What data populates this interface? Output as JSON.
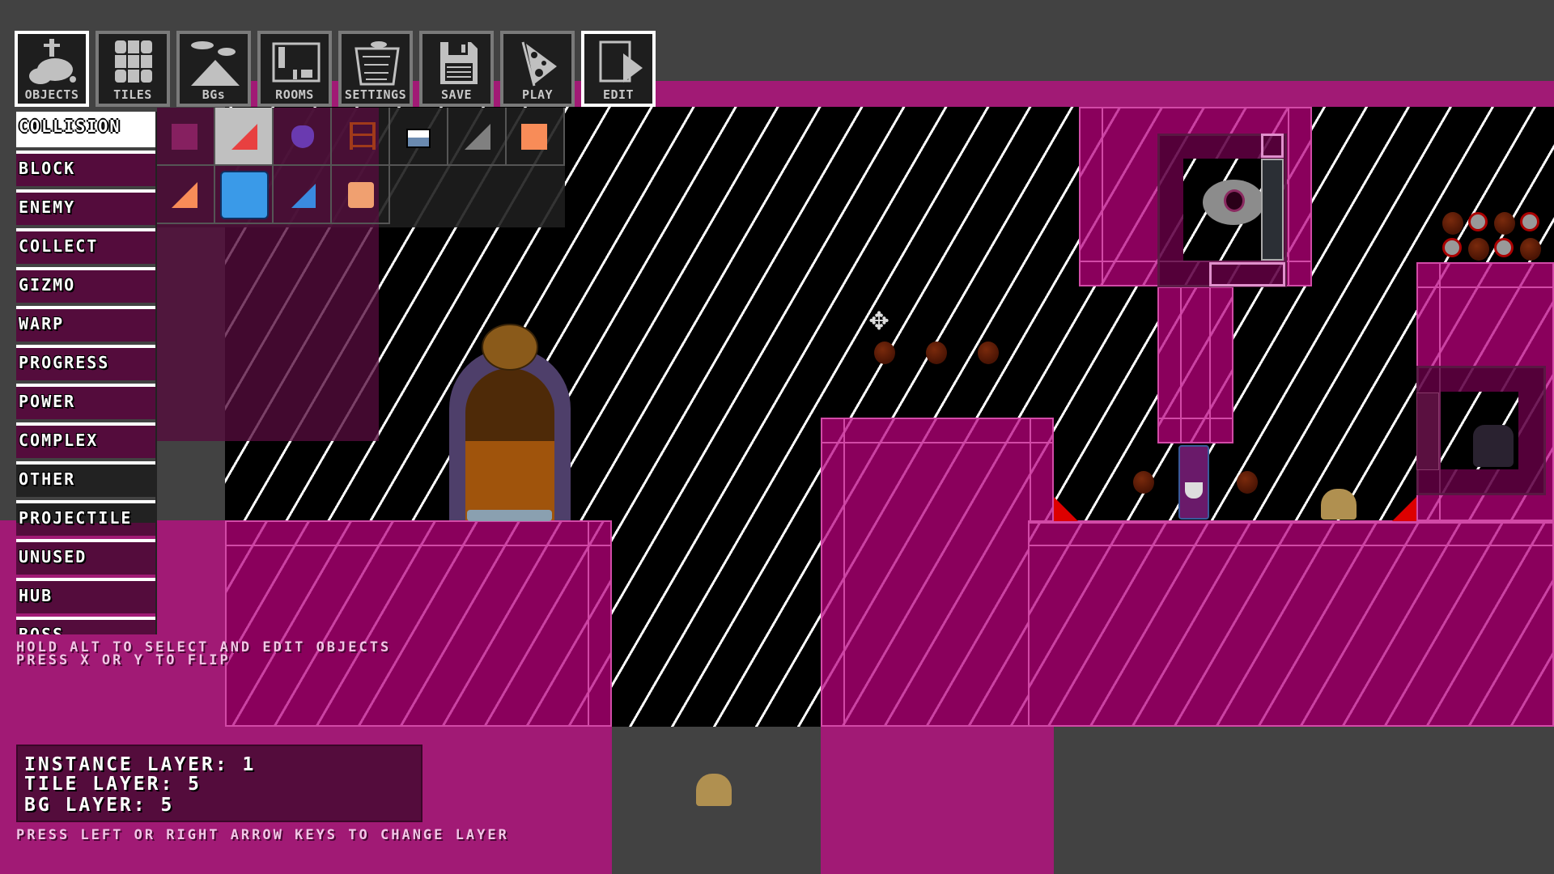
{
  "toolbar": {
    "buttons": [
      {
        "label": "OBJECTS",
        "icon": "objects-icon",
        "active": true
      },
      {
        "label": "TILES",
        "icon": "tiles-icon",
        "active": false
      },
      {
        "label": "BGs",
        "icon": "backgrounds-icon",
        "active": false
      },
      {
        "label": "ROOMS",
        "icon": "rooms-icon",
        "active": false
      },
      {
        "label": "SETTINGS",
        "icon": "settings-icon",
        "active": false
      },
      {
        "label": "SAVE",
        "icon": "save-floppy-icon",
        "active": false
      },
      {
        "label": "PLAY",
        "icon": "pizza-play-icon",
        "active": false
      },
      {
        "label": "EDIT",
        "icon": "edit-icon",
        "active": true
      }
    ]
  },
  "categories": {
    "selected": "COLLISION",
    "items": [
      "COLLISION",
      "BLOCK",
      "ENEMY",
      "COLLECT",
      "GIZMO",
      "WARP",
      "PROGRESS",
      "POWER",
      "COMPLEX",
      "OTHER",
      "PROJECTILE",
      "UNUSED",
      "HUB",
      "BOSS"
    ]
  },
  "palette": {
    "items": [
      {
        "name": "solid-block",
        "selected": false
      },
      {
        "name": "slope-red",
        "selected": true
      },
      {
        "name": "purple-hanging-enemy",
        "selected": false
      },
      {
        "name": "ladder",
        "selected": false
      },
      {
        "name": "platform",
        "selected": false
      },
      {
        "name": "slope-grey",
        "selected": false
      },
      {
        "name": "orange-block",
        "selected": false
      },
      {
        "name": "slope-orange",
        "selected": false
      },
      {
        "name": "ice-block",
        "selected": false
      },
      {
        "name": "slope-blue",
        "selected": false
      },
      {
        "name": "face-block",
        "selected": false
      }
    ]
  },
  "help": {
    "line1": "HOLD ALT TO SELECT AND EDIT OBJECTS",
    "line2": "PRESS X OR Y TO FLIP"
  },
  "layers": {
    "instance": "INSTANCE LAYER: 1",
    "tile": "TILE LAYER: 5",
    "bg": "BG LAYER: 5",
    "hint": "PRESS LEFT OR RIGHT ARROW KEYS TO CHANGE LAYER"
  },
  "colors": {
    "collision_magenta": "#8a005c",
    "outside_magenta": "#a11a75",
    "panel_dark": "#540c3c",
    "background_grey": "#424242"
  }
}
